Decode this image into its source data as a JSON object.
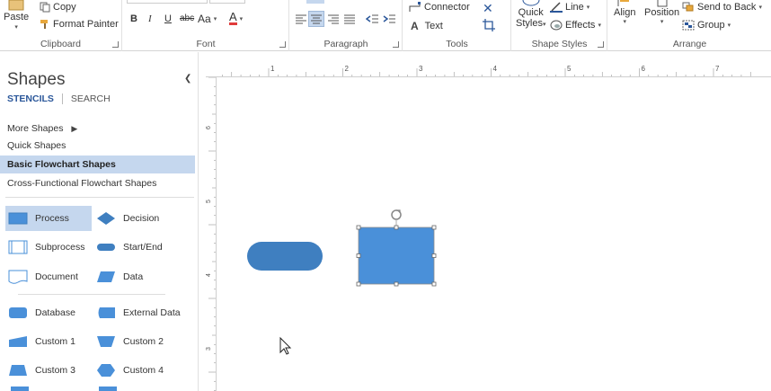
{
  "ribbon": {
    "clipboard": {
      "label": "Clipboard",
      "paste": "Paste",
      "copy": "Copy",
      "format_painter": "Format Painter"
    },
    "font": {
      "label": "Font",
      "bold": "B",
      "italic": "I",
      "underline": "U",
      "strike": "abc",
      "case": "Aa",
      "color_letter": "A"
    },
    "paragraph": {
      "label": "Paragraph"
    },
    "tools": {
      "label": "Tools",
      "connector": "Connector",
      "text": "Text"
    },
    "shape_styles": {
      "label": "Shape Styles",
      "quick_styles_1": "Quick",
      "quick_styles_2": "Styles",
      "line": "Line",
      "effects": "Effects"
    },
    "arrange": {
      "label": "Arrange",
      "align": "Align",
      "position": "Position",
      "send_to_back": "Send to Back",
      "group": "Group"
    }
  },
  "panel": {
    "title": "Shapes",
    "tabs": {
      "stencils": "STENCILS",
      "search": "SEARCH"
    },
    "stencils": [
      {
        "label": "More Shapes",
        "selected": false,
        "has_arrow": true
      },
      {
        "label": "Quick Shapes",
        "selected": false
      },
      {
        "label": "Basic Flowchart Shapes",
        "selected": true
      },
      {
        "label": "Cross-Functional Flowchart Shapes",
        "selected": false
      }
    ],
    "shapes": [
      {
        "label": "Process",
        "icon": "process-icon",
        "selected": true
      },
      {
        "label": "Decision",
        "icon": "decision-icon"
      },
      {
        "label": "Subprocess",
        "icon": "subprocess-icon"
      },
      {
        "label": "Start/End",
        "icon": "start-end-icon"
      },
      {
        "label": "Document",
        "icon": "document-icon"
      },
      {
        "label": "Data",
        "icon": "data-icon"
      },
      {
        "label": "Database",
        "icon": "database-icon"
      },
      {
        "label": "External Data",
        "icon": "external-data-icon"
      },
      {
        "label": "Custom 1",
        "icon": "custom1-icon"
      },
      {
        "label": "Custom 2",
        "icon": "custom2-icon"
      },
      {
        "label": "Custom 3",
        "icon": "custom3-icon"
      },
      {
        "label": "Custom 4",
        "icon": "custom4-icon"
      }
    ]
  },
  "ruler": {
    "h_numbers": [
      "1",
      "2",
      "3",
      "4",
      "5",
      "6",
      "7"
    ],
    "v_numbers": [
      "6",
      "5",
      "4",
      "3"
    ]
  },
  "colors": {
    "accent": "#2b579a",
    "shape_fill": "#4a90d9",
    "shape_dark": "#3f7fc0",
    "selected_bg": "#c5d7ee",
    "font_color_bar": "#e03b3b"
  }
}
